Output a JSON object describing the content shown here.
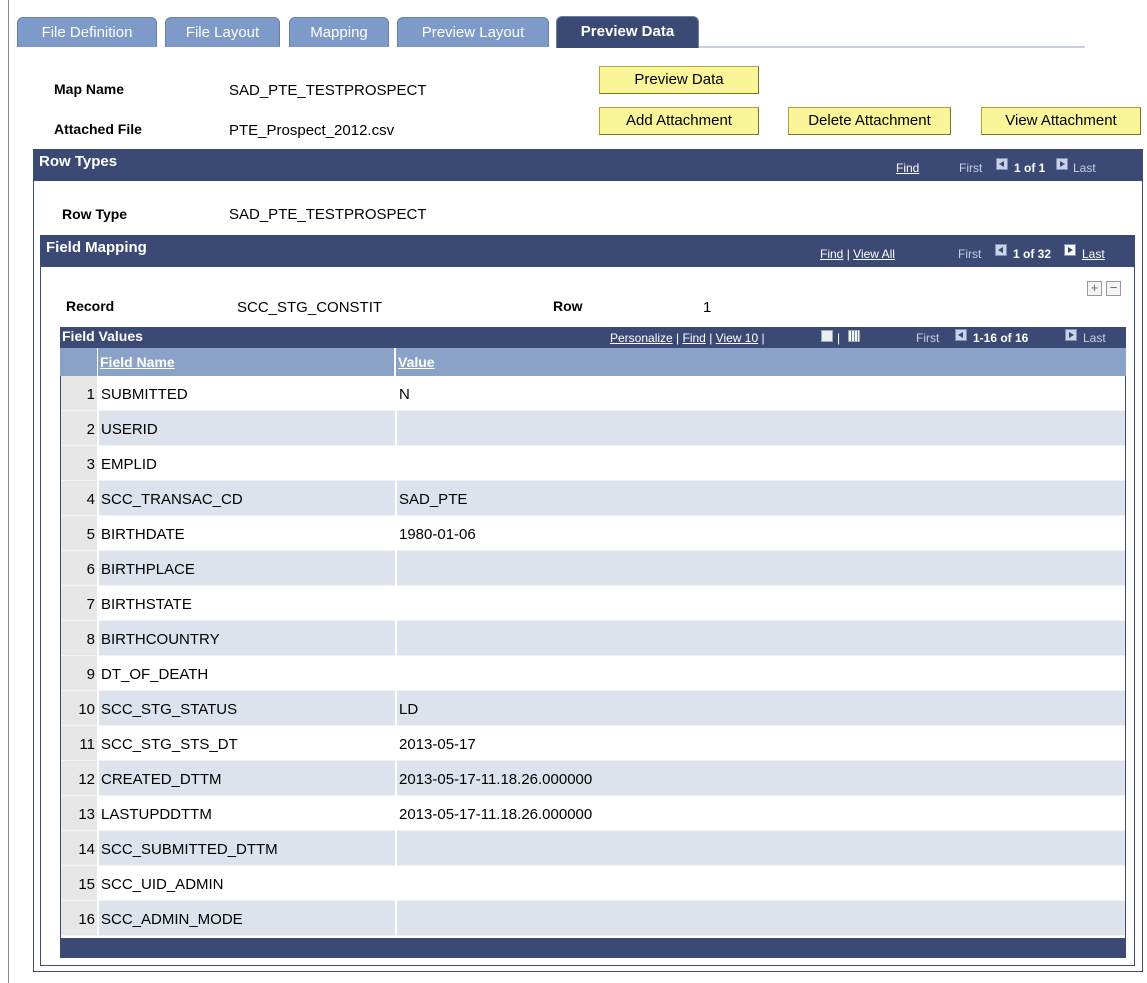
{
  "tabs": [
    {
      "label": "File Definition"
    },
    {
      "label": "File Layout"
    },
    {
      "label": "Mapping"
    },
    {
      "label": "Preview Layout"
    },
    {
      "label": "Preview Data"
    }
  ],
  "header": {
    "map_name_label": "Map Name",
    "map_name_value": "SAD_PTE_TESTPROSPECT",
    "attached_file_label": "Attached File",
    "attached_file_value": "PTE_Prospect_2012.csv"
  },
  "buttons": {
    "preview_data": "Preview Data",
    "add_attachment": "Add Attachment",
    "delete_attachment": "Delete Attachment",
    "view_attachment": "View Attachment"
  },
  "row_types": {
    "title": "Row Types",
    "find": "Find",
    "first": "First",
    "count": "1 of 1",
    "last": "Last",
    "row_type_label": "Row Type",
    "row_type_value": "SAD_PTE_TESTPROSPECT"
  },
  "field_mapping": {
    "title": "Field Mapping",
    "find": "Find",
    "sep": "|",
    "view_all": "View All",
    "first": "First",
    "count": "1 of 32",
    "last": "Last",
    "record_label": "Record",
    "record_value": "SCC_STG_CONSTIT",
    "row_label": "Row",
    "row_value": "1",
    "add": "+",
    "remove": "−"
  },
  "field_values": {
    "title": "Field Values",
    "personalize": "Personalize",
    "find": "Find",
    "view10": "View 10",
    "sep1": "|",
    "sep2": "|",
    "sep3": "|",
    "sep4": "|",
    "first": "First",
    "count": "1-16 of 16",
    "last": "Last",
    "col_field_name": "Field Name",
    "col_value": "Value",
    "rows": [
      {
        "num": "1",
        "name": "SUBMITTED",
        "value": "N"
      },
      {
        "num": "2",
        "name": "USERID",
        "value": ""
      },
      {
        "num": "3",
        "name": "EMPLID",
        "value": ""
      },
      {
        "num": "4",
        "name": "SCC_TRANSAC_CD",
        "value": "SAD_PTE"
      },
      {
        "num": "5",
        "name": "BIRTHDATE",
        "value": "1980-01-06"
      },
      {
        "num": "6",
        "name": "BIRTHPLACE",
        "value": ""
      },
      {
        "num": "7",
        "name": "BIRTHSTATE",
        "value": ""
      },
      {
        "num": "8",
        "name": "BIRTHCOUNTRY",
        "value": ""
      },
      {
        "num": "9",
        "name": "DT_OF_DEATH",
        "value": ""
      },
      {
        "num": "10",
        "name": "SCC_STG_STATUS",
        "value": "LD"
      },
      {
        "num": "11",
        "name": "SCC_STG_STS_DT",
        "value": "2013-05-17"
      },
      {
        "num": "12",
        "name": "CREATED_DTTM",
        "value": "2013-05-17-11.18.26.000000"
      },
      {
        "num": "13",
        "name": "LASTUPDDTTM",
        "value": "2013-05-17-11.18.26.000000"
      },
      {
        "num": "14",
        "name": "SCC_SUBMITTED_DTTM",
        "value": ""
      },
      {
        "num": "15",
        "name": "SCC_UID_ADMIN",
        "value": ""
      },
      {
        "num": "16",
        "name": "SCC_ADMIN_MODE",
        "value": ""
      }
    ]
  },
  "colors": {
    "header_bar": "#3b4a74",
    "tab_inactive": "#7d9ac9",
    "button_bg": "#fbf59a",
    "row_alt": "#dde3ec"
  }
}
